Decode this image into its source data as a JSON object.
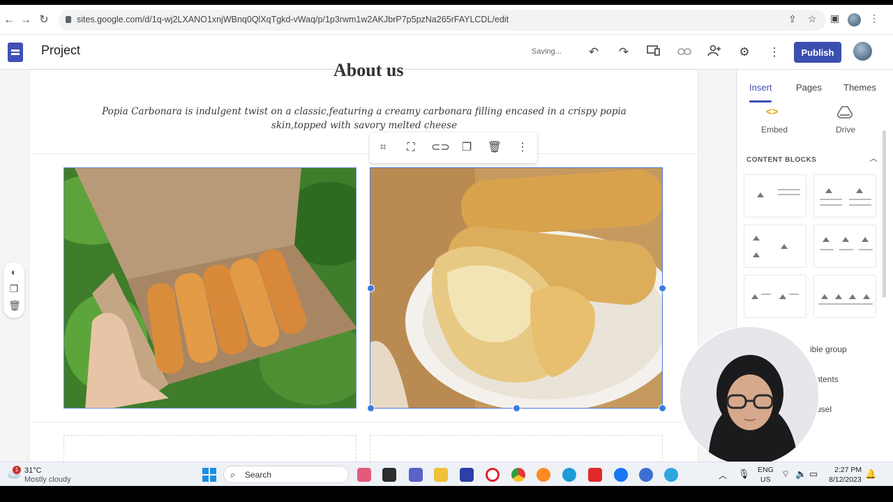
{
  "browser": {
    "url": "sites.google.com/d/1q-wj2LXANO1xnjWBnq0QlXqTgkd-vWaq/p/1p3rwm1w2AKJbrP7p5pzNa265rFAYLCDL/edit"
  },
  "header": {
    "project_title": "Project",
    "status": "Saving...",
    "publish_label": "Publish"
  },
  "page": {
    "heading_fragment": "About us",
    "description": "Popia Carbonara is indulgent twist on a classic,featuring a creamy carbonara filling encased in a crispy popia skin,topped with savory melted cheese"
  },
  "panel": {
    "tabs": [
      {
        "label": "Insert",
        "active": true
      },
      {
        "label": "Pages",
        "active": false
      },
      {
        "label": "Themes",
        "active": false
      }
    ],
    "embed_label": "Embed",
    "drive_label": "Drive",
    "content_blocks_title": "CONTENT BLOCKS",
    "more_items": [
      "ible group",
      "ntents",
      "usel"
    ]
  },
  "taskbar": {
    "weather_temp": "31°C",
    "weather_desc": "Mostly cloudy",
    "alert_count": "1",
    "search_label": "Search",
    "lang_top": "ENG",
    "lang_bottom": "US",
    "time": "2:27 PM",
    "date": "8/12/2023"
  },
  "colors": {
    "accent": "#3b4fb0",
    "selection": "#3b7be0"
  }
}
